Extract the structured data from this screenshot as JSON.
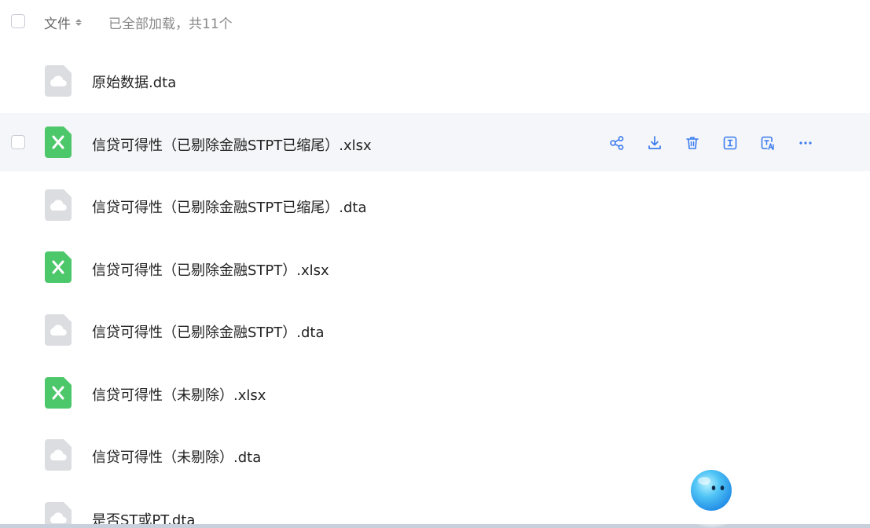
{
  "header": {
    "column_label": "文件",
    "load_status": "已全部加载，共11个"
  },
  "files": [
    {
      "name": "原始数据.dta",
      "type": "dta"
    },
    {
      "name": "信贷可得性（已剔除金融STPT已缩尾）.xlsx",
      "type": "xlsx"
    },
    {
      "name": "信贷可得性（已剔除金融STPT已缩尾）.dta",
      "type": "dta"
    },
    {
      "name": "信贷可得性（已剔除金融STPT）.xlsx",
      "type": "xlsx"
    },
    {
      "name": "信贷可得性（已剔除金融STPT）.dta",
      "type": "dta"
    },
    {
      "name": "信贷可得性（未剔除）.xlsx",
      "type": "xlsx"
    },
    {
      "name": "信贷可得性（未剔除）.dta",
      "type": "dta"
    },
    {
      "name": "是否ST或PT.dta",
      "type": "dta"
    }
  ],
  "row_actions": [
    "share-icon",
    "download-icon",
    "delete-icon",
    "rename-icon",
    "translate-icon",
    "more-icon"
  ],
  "colors": {
    "accent": "#3a7bf0",
    "xlsx_icon": "#4cc76a",
    "dta_icon": "#dcdde0",
    "hover_row": "#f5f6f9"
  }
}
